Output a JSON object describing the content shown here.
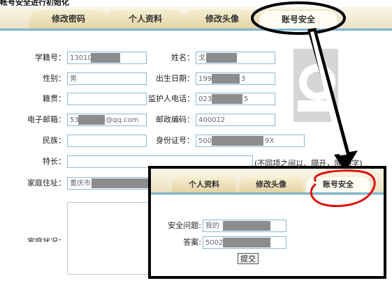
{
  "caption_fragment": "帐号安全进行初始化",
  "tabs": [
    {
      "label": "修改密码",
      "active": false
    },
    {
      "label": "个人资料",
      "active": false
    },
    {
      "label": "修改头像",
      "active": false
    },
    {
      "label": "账号安全",
      "active": true
    }
  ],
  "form": {
    "student_id": {
      "label": "学籍号：",
      "value": "13010"
    },
    "name": {
      "label": "姓名：",
      "value": "戈"
    },
    "gender": {
      "label": "性别：",
      "value": "男"
    },
    "birth_date": {
      "label": "出生日期：",
      "value_prefix": "199",
      "value_suffix": "3"
    },
    "native_place": {
      "label": "籍贯：",
      "value": ""
    },
    "guardian_phone": {
      "label": "监护人电话：",
      "value_prefix": "023",
      "value_suffix": "5"
    },
    "email": {
      "label": "电子邮箱：",
      "value_prefix": "53",
      "value_suffix": "@qq.com"
    },
    "postcode": {
      "label": "邮政编码：",
      "value": "400012"
    },
    "ethnicity": {
      "label": "民族：",
      "value": ""
    },
    "id_number": {
      "label": "身份证号：",
      "value_prefix": "500",
      "value_suffix": "9X"
    },
    "specialty": {
      "label": "特长：",
      "value": "",
      "hint": "(不同项之间以、隔开，限50字)"
    },
    "address": {
      "label": "家庭住址：",
      "value_prefix": "重庆市"
    },
    "cut_label": "家庭状况："
  },
  "popup": {
    "tabs": [
      {
        "label": "个人资料",
        "active": false
      },
      {
        "label": "修改头像",
        "active": false
      },
      {
        "label": "账号安全",
        "active": true
      }
    ],
    "question_label": "安全问题:",
    "question_value": "我的",
    "answer_label": "答案:",
    "answer_value": "5002",
    "submit_label": "提交"
  },
  "colors": {
    "accent_line": "#7bb6d2",
    "input_border": "#8fb7d6",
    "annotation_red": "#e01010",
    "annotation_black": "#000000"
  }
}
